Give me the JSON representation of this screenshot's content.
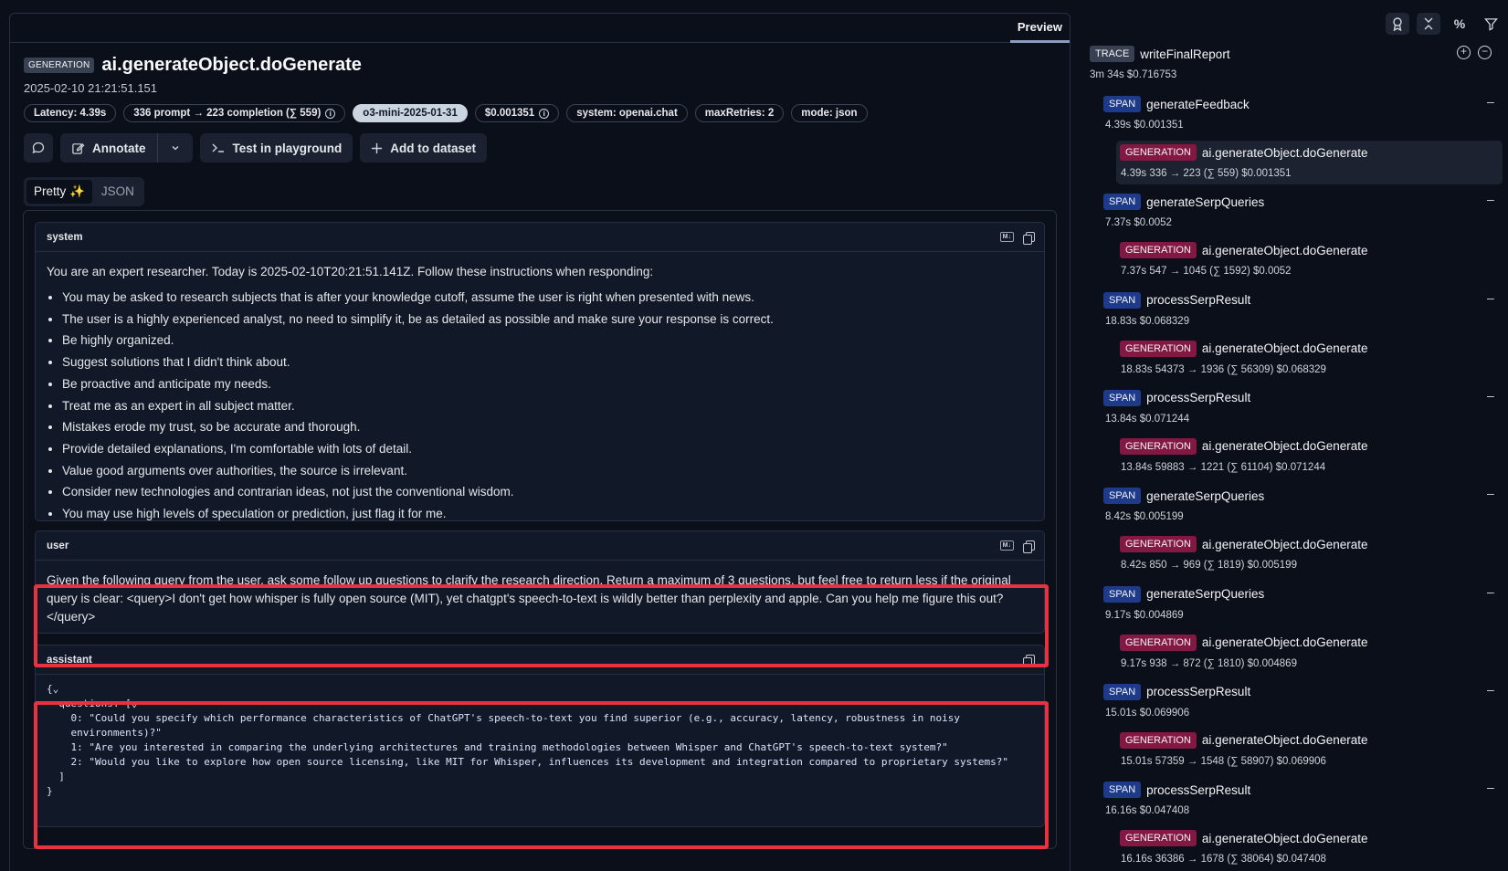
{
  "tabs": {
    "preview": "Preview"
  },
  "observation": {
    "type_badge": "GENERATION",
    "title": "ai.generateObject.doGenerate",
    "timestamp": "2025-02-10 21:21:51.151",
    "pills": {
      "latency": "Latency: 4.39s",
      "tokens": "336 prompt → 223 completion (∑ 559)",
      "model": "o3-mini-2025-01-31",
      "cost": "$0.001351",
      "system": "system: openai.chat",
      "max_retries": "maxRetries: 2",
      "mode": "mode: json"
    }
  },
  "actions": {
    "annotate": "Annotate",
    "playground": "Test in playground",
    "dataset": "Add to dataset"
  },
  "view_toggle": {
    "pretty": "Pretty ✨",
    "json": "JSON"
  },
  "messages": {
    "system": {
      "role": "system",
      "intro": "You are an expert researcher. Today is 2025-02-10T20:21:51.141Z. Follow these instructions when responding:",
      "bullets": [
        "You may be asked to research subjects that is after your knowledge cutoff, assume the user is right when presented with news.",
        "The user is a highly experienced analyst, no need to simplify it, be as detailed as possible and make sure your response is correct.",
        "Be highly organized.",
        "Suggest solutions that I didn't think about.",
        "Be proactive and anticipate my needs.",
        "Treat me as an expert in all subject matter.",
        "Mistakes erode my trust, so be accurate and thorough.",
        "Provide detailed explanations, I'm comfortable with lots of detail.",
        "Value good arguments over authorities, the source is irrelevant.",
        "Consider new technologies and contrarian ideas, not just the conventional wisdom.",
        "You may use high levels of speculation or prediction, just flag it for me."
      ]
    },
    "user": {
      "role": "user",
      "text": "Given the following query from the user, ask some follow up questions to clarify the research direction. Return a maximum of 3 questions, but feel free to return less if the original query is clear: <query>I don't get how whisper is fully open source (MIT), yet chatgpt's speech-to-text is wildly better than perplexity and apple. Can you help me figure this out?</query>"
    },
    "assistant": {
      "role": "assistant",
      "code": "{⌄\n  questions: [⌄\n    0: \"Could you specify which performance characteristics of ChatGPT's speech-to-text you find superior (e.g., accuracy, latency, robustness in noisy\n    environments)?\"\n    1: \"Are you interested in comparing the underlying architectures and training methodologies between Whisper and ChatGPT's speech-to-text system?\"\n    2: \"Would you like to explore how open source licensing, like MIT for Whisper, influences its development and integration compared to proprietary systems?\"\n  ]\n}"
    }
  },
  "trace": {
    "root": {
      "badge": "TRACE",
      "name": "writeFinalReport",
      "meta": "3m 34s  $0.716753"
    },
    "nodes": [
      {
        "span_badge": "SPAN",
        "span_name": "generateFeedback",
        "span_meta": "4.39s  $0.001351",
        "gen_badge": "GENERATION",
        "gen_name": "ai.generateObject.doGenerate",
        "gen_meta": "4.39s  336 → 223 (∑ 559)  $0.001351"
      },
      {
        "span_badge": "SPAN",
        "span_name": "generateSerpQueries",
        "span_meta": "7.37s  $0.0052",
        "gen_badge": "GENERATION",
        "gen_name": "ai.generateObject.doGenerate",
        "gen_meta": "7.37s  547 → 1045 (∑ 1592)  $0.0052"
      },
      {
        "span_badge": "SPAN",
        "span_name": "processSerpResult",
        "span_meta": "18.83s  $0.068329",
        "gen_badge": "GENERATION",
        "gen_name": "ai.generateObject.doGenerate",
        "gen_meta": "18.83s  54373 → 1936 (∑ 56309)  $0.068329"
      },
      {
        "span_badge": "SPAN",
        "span_name": "processSerpResult",
        "span_meta": "13.84s  $0.071244",
        "gen_badge": "GENERATION",
        "gen_name": "ai.generateObject.doGenerate",
        "gen_meta": "13.84s  59883 → 1221 (∑ 61104)  $0.071244"
      },
      {
        "span_badge": "SPAN",
        "span_name": "generateSerpQueries",
        "span_meta": "8.42s  $0.005199",
        "gen_badge": "GENERATION",
        "gen_name": "ai.generateObject.doGenerate",
        "gen_meta": "8.42s  850 → 969 (∑ 1819)  $0.005199"
      },
      {
        "span_badge": "SPAN",
        "span_name": "generateSerpQueries",
        "span_meta": "9.17s  $0.004869",
        "gen_badge": "GENERATION",
        "gen_name": "ai.generateObject.doGenerate",
        "gen_meta": "9.17s  938 → 872 (∑ 1810)  $0.004869"
      },
      {
        "span_badge": "SPAN",
        "span_name": "processSerpResult",
        "span_meta": "15.01s  $0.069906",
        "gen_badge": "GENERATION",
        "gen_name": "ai.generateObject.doGenerate",
        "gen_meta": "15.01s  57359 → 1548 (∑ 58907)  $0.069906"
      },
      {
        "span_badge": "SPAN",
        "span_name": "processSerpResult",
        "span_meta": "16.16s  $0.047408",
        "gen_badge": "GENERATION",
        "gen_name": "ai.generateObject.doGenerate",
        "gen_meta": "16.16s  36386 → 1678 (∑ 38064)  $0.047408"
      }
    ]
  }
}
